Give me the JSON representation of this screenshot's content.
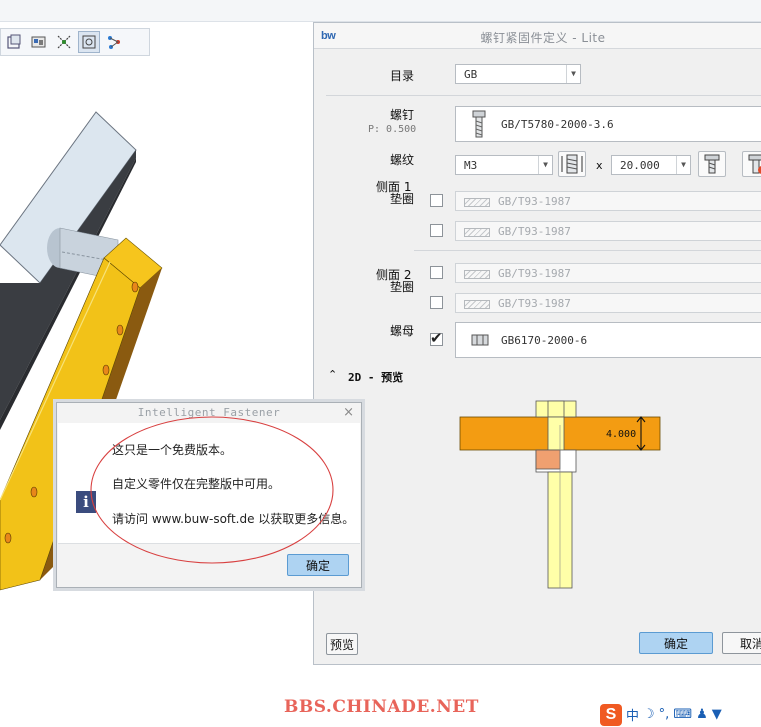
{
  "dialog": {
    "logo": "bw",
    "title": "螺钉紧固件定义 - Lite",
    "catalog_label": "目录",
    "catalog_value": "GB",
    "screw_label": "螺钉",
    "pitch_text": "P: 0.500",
    "screw_value": "GB/T5780-2000-3.6",
    "thread_label": "螺纹",
    "thread_value": "M3",
    "times": "x",
    "length_value": "20.000",
    "side1_label_a": "侧面 1",
    "side1_label_b": "垫圈",
    "side1_washer1": "GB/T93-1987",
    "side1_washer2": "GB/T93-1987",
    "side2_label_a": "侧面 2",
    "side2_label_b": "垫圈",
    "side2_washer1": "GB/T93-1987",
    "side2_washer2": "GB/T93-1987",
    "nut_label": "螺母",
    "nut_value": "GB6170-2000-6",
    "preview_toggle": "⌃",
    "preview_header": "2D - 预览",
    "dimension_value": "4.000",
    "preview_button": "预览",
    "ok_button": "确定",
    "cancel_button": "取消"
  },
  "popup": {
    "title": "Intelligent Fastener",
    "close": "×",
    "info_glyph": "i",
    "line1": "这只是一个免费版本。",
    "line2": "自定义零件仅在完整版中可用。",
    "line3": "请访问 www.buw-soft.de 以获取更多信息。",
    "ok_button": "确定"
  },
  "watermark": "BBS.CHINADE.NET",
  "ime": {
    "logo": "S",
    "mode": "中"
  },
  "colors": {
    "orange_plate": "#f39c12",
    "yellow_bar": "#f2c218",
    "dark_plate": "#3a3d42",
    "primary_button": "#aed3f2"
  }
}
